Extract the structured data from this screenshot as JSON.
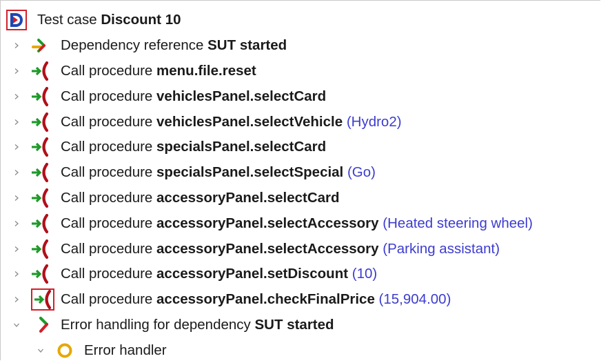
{
  "tree": {
    "root": {
      "label": "Test case",
      "name": "Discount 10",
      "icon": "test-case-icon"
    },
    "items": [
      {
        "label": "Dependency reference",
        "name": "SUT started",
        "param": "",
        "icon": "dependency-reference-icon",
        "expander": "collapsed"
      },
      {
        "label": "Call procedure",
        "name": "menu.file.reset",
        "param": "",
        "icon": "procedure-call-icon",
        "expander": "collapsed"
      },
      {
        "label": "Call procedure",
        "name": "vehiclesPanel.selectCard",
        "param": "",
        "icon": "procedure-call-icon",
        "expander": "collapsed"
      },
      {
        "label": "Call procedure",
        "name": "vehiclesPanel.selectVehicle",
        "param": "(Hydro2)",
        "icon": "procedure-call-icon",
        "expander": "collapsed"
      },
      {
        "label": "Call procedure",
        "name": "specialsPanel.selectCard",
        "param": "",
        "icon": "procedure-call-icon",
        "expander": "collapsed"
      },
      {
        "label": "Call procedure",
        "name": "specialsPanel.selectSpecial",
        "param": "(Go)",
        "icon": "procedure-call-icon",
        "expander": "collapsed"
      },
      {
        "label": "Call procedure",
        "name": "accessoryPanel.selectCard",
        "param": "",
        "icon": "procedure-call-icon",
        "expander": "collapsed"
      },
      {
        "label": "Call procedure",
        "name": "accessoryPanel.selectAccessory",
        "param": "(Heated steering wheel)",
        "icon": "procedure-call-icon",
        "expander": "collapsed"
      },
      {
        "label": "Call procedure",
        "name": "accessoryPanel.selectAccessory",
        "param": "(Parking assistant)",
        "icon": "procedure-call-icon",
        "expander": "collapsed"
      },
      {
        "label": "Call procedure",
        "name": "accessoryPanel.setDiscount",
        "param": "(10)",
        "icon": "procedure-call-icon",
        "expander": "collapsed"
      },
      {
        "label": "Call procedure",
        "name": "accessoryPanel.checkFinalPrice",
        "param": "(15,904.00)",
        "icon": "procedure-call-icon",
        "expander": "collapsed",
        "highlighted": true
      },
      {
        "label": "Error handling for dependency",
        "name": "SUT started",
        "param": "",
        "icon": "error-handling-icon",
        "expander": "expanded"
      },
      {
        "label": "Error handler",
        "name": "",
        "param": "",
        "icon": "error-handler-icon",
        "expander": "expanded"
      }
    ]
  },
  "colors": {
    "parameter": "#3c3cd0",
    "highlight_box": "#d0202a",
    "arrow_green": "#1e9a2a",
    "call_red": "#b0101a",
    "handler_ring": "#e6a800"
  }
}
